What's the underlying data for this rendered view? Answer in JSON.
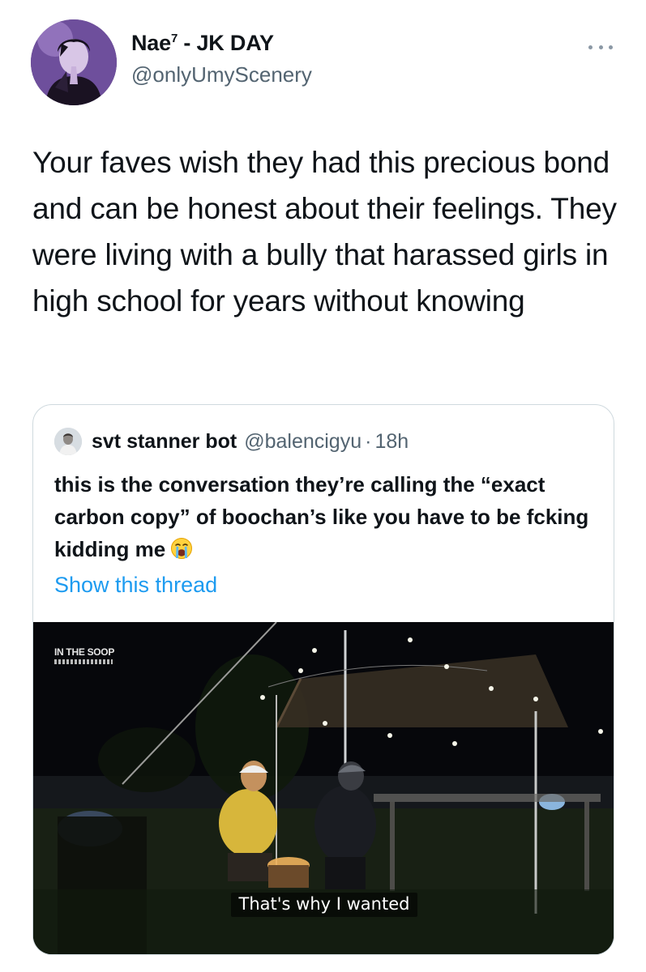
{
  "tweet": {
    "display_name": "Nae",
    "display_name_sup": "7",
    "display_name_suffix": " - JK DAY",
    "handle": "@onlyUmyScenery",
    "text": "Your faves wish they had this precious bond and can be honest about their feelings. They were living with a bully that harassed girls in high school for years without knowing"
  },
  "quoted": {
    "display_name": "svt stanner bot",
    "handle": "@balencigyu",
    "separator": "·",
    "time": "18h",
    "text": "this is the conversation they’re calling the “exact carbon copy” of boochan’s like you have to be fcking kidding me",
    "emoji": "loudly-crying-face",
    "show_thread": "Show this thread",
    "media": {
      "watermark": "IN THE SOOP",
      "subtitle": "That's why I wanted"
    }
  },
  "colors": {
    "text": "#0f1419",
    "secondary": "#536471",
    "link": "#1d9bf0",
    "border": "#cfd9de"
  },
  "icons": {
    "more": "more-horizontal-icon"
  }
}
